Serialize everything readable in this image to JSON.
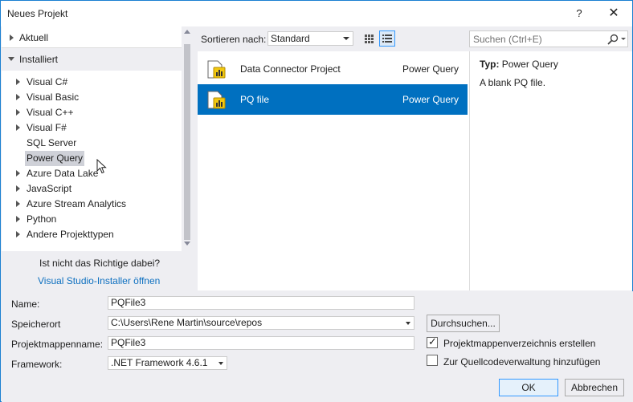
{
  "window": {
    "title": "Neues Projekt",
    "help_label": "?",
    "close_label": "✕"
  },
  "sidebar": {
    "recent_label": "Aktuell",
    "installed_label": "Installiert",
    "items": [
      {
        "label": "Visual C#",
        "expandable": true
      },
      {
        "label": "Visual Basic",
        "expandable": true
      },
      {
        "label": "Visual C++",
        "expandable": true
      },
      {
        "label": "Visual F#",
        "expandable": true
      },
      {
        "label": "SQL Server",
        "expandable": false
      },
      {
        "label": "Power Query",
        "expandable": false,
        "selected": true
      },
      {
        "label": "Azure Data Lake",
        "expandable": true
      },
      {
        "label": "JavaScript",
        "expandable": true
      },
      {
        "label": "Azure Stream Analytics",
        "expandable": true
      },
      {
        "label": "Python",
        "expandable": true
      },
      {
        "label": "Andere Projekttypen",
        "expandable": true
      }
    ],
    "not_found_text": "Ist nicht das Richtige dabei?",
    "installer_link": "Visual Studio-Installer öffnen"
  },
  "toolbar": {
    "sort_label": "Sortieren nach:",
    "sort_value": "Standard"
  },
  "templates": [
    {
      "name": "Data Connector Project",
      "language": "Power Query",
      "selected": false
    },
    {
      "name": "PQ file",
      "language": "Power Query",
      "selected": true
    }
  ],
  "search": {
    "placeholder": "Suchen (Ctrl+E)"
  },
  "details": {
    "type_label": "Typ:",
    "type_value": "Power Query",
    "description": "A blank PQ file."
  },
  "form": {
    "name_label": "Name:",
    "name_value": "PQFile3",
    "location_label": "Speicherort",
    "location_value": "C:\\Users\\Rene Martin\\source\\repos",
    "solution_label": "Projektmappenname:",
    "solution_value": "PQFile3",
    "framework_label": "Framework:",
    "framework_value": ".NET Framework 4.6.1",
    "browse_label": "Durchsuchen...",
    "create_dir_label": "Projektmappenverzeichnis erstellen",
    "create_dir_checked": true,
    "source_control_label": "Zur Quellcodeverwaltung hinzufügen",
    "source_control_checked": false,
    "ok_label": "OK",
    "cancel_label": "Abbrechen"
  },
  "colors": {
    "accent": "#0070c0",
    "link": "#0e70c0",
    "window_border": "#1a7fd1",
    "chrome_bg": "#eeeef2"
  }
}
